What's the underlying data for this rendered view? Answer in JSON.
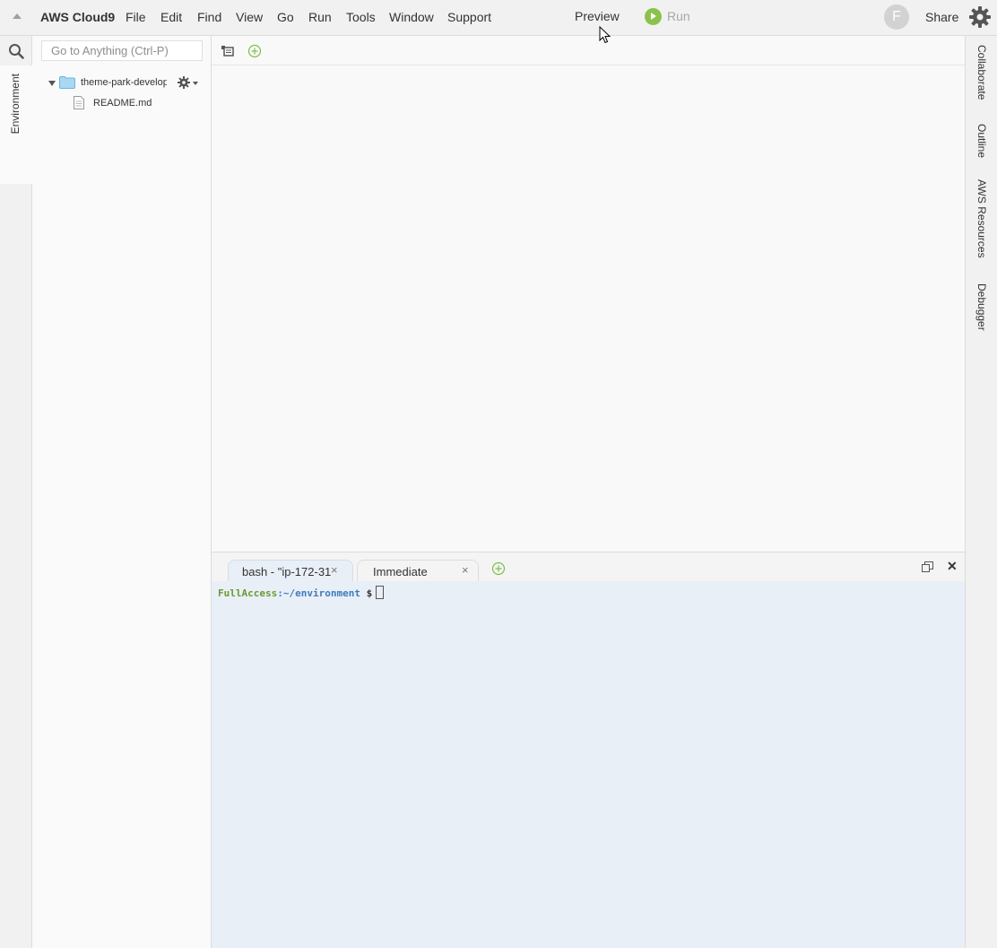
{
  "menubar": {
    "brand": "AWS Cloud9",
    "items": [
      "File",
      "Edit",
      "Find",
      "View",
      "Go",
      "Run",
      "Tools",
      "Window",
      "Support"
    ],
    "preview": "Preview",
    "run": "Run",
    "avatar_letter": "F",
    "share": "Share"
  },
  "left_strip": {
    "environment_tab": "Environment"
  },
  "tree": {
    "goto_placeholder": "Go to Anything (Ctrl-P)",
    "folder": "theme-park-develop",
    "files": [
      "README.md"
    ]
  },
  "right_strip": {
    "tabs": [
      "Collaborate",
      "Outline",
      "AWS Resources",
      "Debugger"
    ]
  },
  "console": {
    "tabs": [
      {
        "label": "bash - \"ip-172-31",
        "active": true
      },
      {
        "label": "Immediate",
        "active": false
      }
    ],
    "prompt_user": "FullAccess",
    "prompt_path": ":~/environment",
    "prompt_sign": "$"
  },
  "colors": {
    "run_green": "#8bc34a",
    "terminal_bg": "#e9eff7",
    "prompt_green": "#6a9a30",
    "prompt_blue": "#3f7bbf"
  },
  "icons": {
    "collapse": "collapse-arrow-icon",
    "gear": "gear-icon",
    "search": "search-icon",
    "folder": "folder-icon",
    "file": "file-icon",
    "add": "plus-circle-icon",
    "restore": "restore-icon",
    "close": "close-icon"
  }
}
